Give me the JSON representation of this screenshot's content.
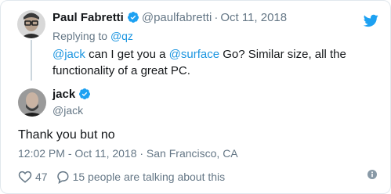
{
  "parent": {
    "name": "Paul Fabretti",
    "handle": "@paulfabretti",
    "separator": "·",
    "date": "Oct 11, 2018",
    "replying_prefix": "Replying to ",
    "replying_to": "@qz",
    "text": {
      "mention1": "@jack",
      "part1": " can I get you a ",
      "mention2": "@surface",
      "part2": " Go? Similar size, all the functionality of a great PC."
    }
  },
  "main": {
    "name": "jack",
    "handle": "@jack",
    "text": "Thank you but no",
    "timestamp": "12:02 PM - Oct 11, 2018 · San Francisco, CA"
  },
  "actions": {
    "likes": "47",
    "talking": "15 people are talking about this"
  },
  "colors": {
    "link": "#1b95e0",
    "verified": "#1da1f2",
    "muted": "#657786",
    "text": "#14171a",
    "thread_line": "#ccd6dd"
  },
  "icons": [
    "verified-badge-icon",
    "twitter-bird-icon",
    "heart-icon",
    "speech-bubble-icon",
    "info-icon"
  ]
}
